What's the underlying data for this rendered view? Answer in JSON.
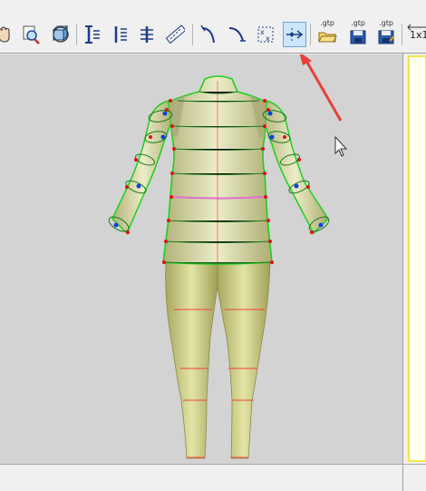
{
  "toolbar": {
    "tools": [
      {
        "icon": "hand-icon"
      },
      {
        "icon": "zoom-icon"
      },
      {
        "icon": "rotate-view-icon"
      },
      {
        "icon": "vertical-measure-icon"
      },
      {
        "icon": "vertical-points-icon"
      },
      {
        "icon": "vertical-lines-icon"
      },
      {
        "icon": "ruler-icon"
      },
      {
        "icon": "curve-left-icon"
      },
      {
        "icon": "curve-right-icon"
      },
      {
        "icon": "points-grid-icon"
      },
      {
        "icon": "insert-point-icon",
        "active": true
      },
      {
        "icon": "open-gtp-icon"
      },
      {
        "icon": "save-gtp-icon"
      },
      {
        "icon": "save-as-gtp-icon"
      }
    ],
    "gtp_labels": [
      ".gtp",
      ".gtp",
      ".gtp"
    ],
    "scale_label": "1x1"
  },
  "colors": {
    "body_fill": "#d2d28a",
    "garment_outline": "#1ecf1e",
    "section_line": "#1a7a1a",
    "waist_line": "#e070d0",
    "measure_line": "#f04040",
    "control_point": "#e01010",
    "control_point_alt": "#1040e0",
    "annotation_arrow": "#e8403a",
    "active_tool": "#cde6fb"
  }
}
